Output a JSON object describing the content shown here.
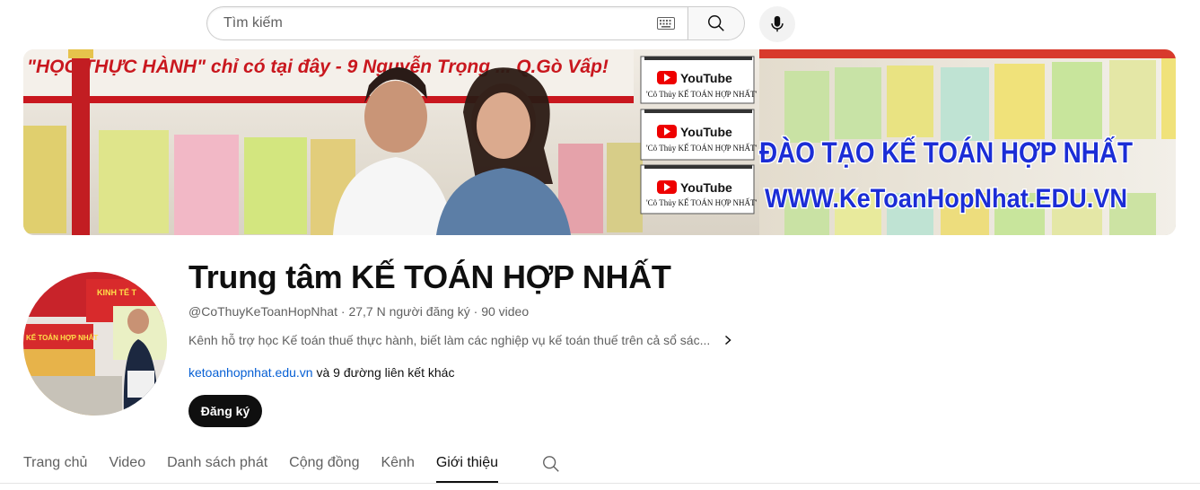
{
  "search": {
    "placeholder": "Tìm kiếm"
  },
  "banner": {
    "youtube_label": "YouTube",
    "badge_caption": "'Cô Thủy KẾ TOÁN HỢP NHẤT'",
    "headline": "ĐÀO TẠO KẾ TOÁN HỢP NHẤT",
    "website": "WWW.KeToanHopNhat.EDU.VN",
    "top_text": "\"HỌC THỰC HÀNH\" chỉ có tại đây - 9 Nguyễn Trọng ... Q.Gò Vấp!"
  },
  "avatar": {
    "sign_1": "KINH TẾ T",
    "sign_2": "KẾ TOÁN HỢP NHẤT"
  },
  "channel": {
    "title": "Trung tâm KẾ TOÁN HỢP NHẤT",
    "handle": "@CoThuyKeToanHopNhat",
    "separator": "·",
    "subscribers": "27,7 N người đăng ký",
    "videos": "90 video",
    "description": "Kênh hỗ trợ học Kế toán thuế thực hành, biết làm các nghiệp vụ kế toán thuế trên cả sổ sác...",
    "link": "ketoanhopnhat.edu.vn",
    "more_links": " và 9 đường liên kết khác",
    "subscribe_label": "Đăng ký"
  },
  "tabs": [
    {
      "label": "Trang chủ",
      "active": false
    },
    {
      "label": "Video",
      "active": false
    },
    {
      "label": "Danh sách phát",
      "active": false
    },
    {
      "label": "Cộng đồng",
      "active": false
    },
    {
      "label": "Kênh",
      "active": false
    },
    {
      "label": "Giới thiệu",
      "active": true
    }
  ],
  "icons": {
    "keyboard": "keyboard-icon",
    "search": "search-icon",
    "mic": "microphone-icon",
    "chevron": "chevron-right-icon",
    "tab_search": "search-icon"
  }
}
